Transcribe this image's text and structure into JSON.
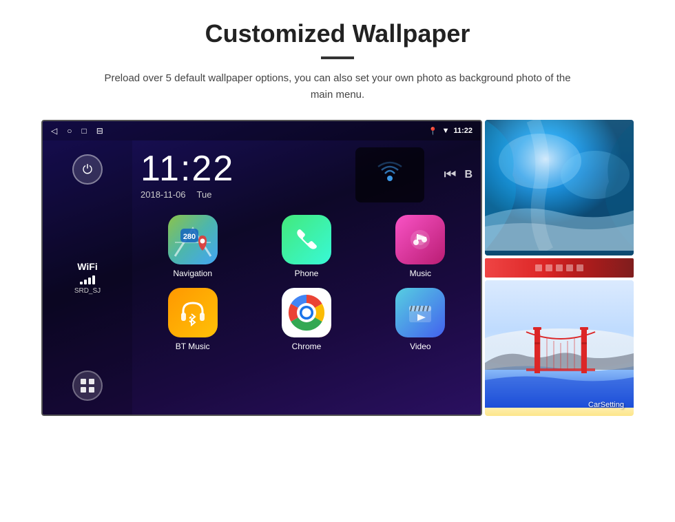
{
  "header": {
    "title": "Customized Wallpaper",
    "subtitle": "Preload over 5 default wallpaper options, you can also set your own photo as background photo of the main menu."
  },
  "android": {
    "status_bar": {
      "time": "11:22",
      "nav_back": "◁",
      "nav_home": "○",
      "nav_recent": "□",
      "nav_screenshot": "⊟",
      "loc_icon": "📍",
      "wifi_icon": "▼",
      "battery_icon": "▮"
    },
    "clock": {
      "time": "11:22",
      "date": "2018-11-06",
      "day": "Tue"
    },
    "sidebar": {
      "power_icon": "⏻",
      "wifi_label": "WiFi",
      "wifi_ssid": "SRD_SJ",
      "apps_icon": "⊞"
    },
    "apps": [
      {
        "id": "navigation",
        "label": "Navigation",
        "icon_type": "nav"
      },
      {
        "id": "phone",
        "label": "Phone",
        "icon_type": "phone"
      },
      {
        "id": "music",
        "label": "Music",
        "icon_type": "music"
      },
      {
        "id": "btmusic",
        "label": "BT Music",
        "icon_type": "btmusic"
      },
      {
        "id": "chrome",
        "label": "Chrome",
        "icon_type": "chrome"
      },
      {
        "id": "video",
        "label": "Video",
        "icon_type": "video"
      }
    ],
    "carsetting_label": "CarSetting"
  },
  "colors": {
    "bg": "#ffffff",
    "title": "#222222",
    "subtitle": "#444444",
    "screen_bg_start": "#1a1060",
    "screen_bg_end": "#2a1060"
  }
}
